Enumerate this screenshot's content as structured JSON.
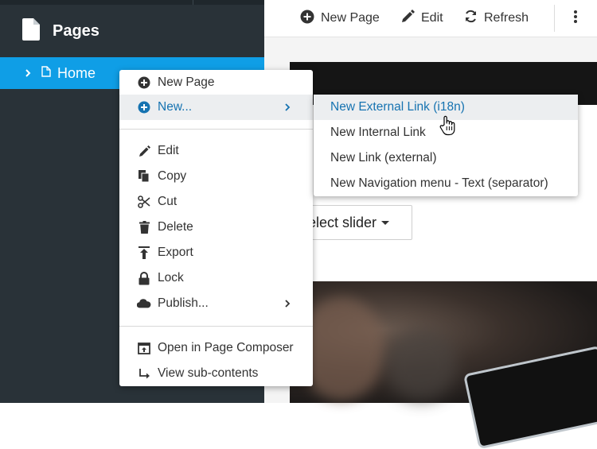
{
  "sidebar": {
    "title": "Pages",
    "tree": [
      {
        "label": "Home",
        "selected": true
      }
    ]
  },
  "toolbar": {
    "new_page_label": "New Page",
    "edit_label": "Edit",
    "refresh_label": "Refresh"
  },
  "content": {
    "select_slider_label": "elect slider"
  },
  "context_menu": {
    "new_page": "New Page",
    "new": "New...",
    "edit": "Edit",
    "copy": "Copy",
    "cut": "Cut",
    "delete": "Delete",
    "export": "Export",
    "lock": "Lock",
    "publish": "Publish...",
    "open_in_page_composer": "Open in Page Composer",
    "view_sub_contents": "View sub-contents"
  },
  "submenu": {
    "items": [
      "New External Link (i18n)",
      "New Internal Link",
      "New Link (external)",
      "New Navigation menu - Text (separator)"
    ]
  },
  "colors": {
    "sidebar_bg": "#293238",
    "selected_bg": "#0f9ee6",
    "link_blue": "#1673b1",
    "menu_highlight": "#eceef0"
  }
}
